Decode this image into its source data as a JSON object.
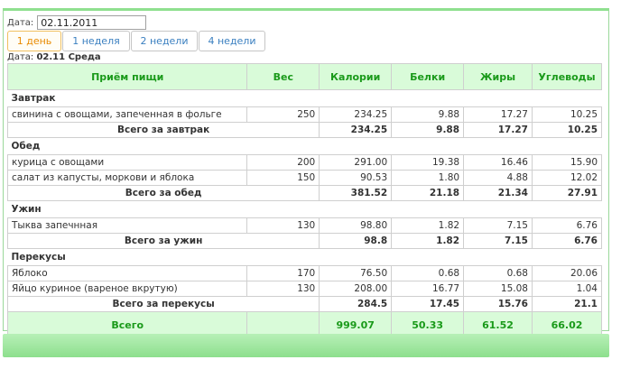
{
  "date_field": {
    "label": "Дата:",
    "value": "02.11.2011"
  },
  "tabs": [
    {
      "label": "1 день",
      "active": true
    },
    {
      "label": "1 неделя",
      "active": false
    },
    {
      "label": "2 недели",
      "active": false
    },
    {
      "label": "4 недели",
      "active": false
    }
  ],
  "day_header": {
    "label": "Дата:",
    "value": "02.11 Среда"
  },
  "columns": [
    "Приём пищи",
    "Вес",
    "Калории",
    "Белки",
    "Жиры",
    "Углеводы"
  ],
  "meals": [
    {
      "name": "Завтрак",
      "items": [
        {
          "name": "свинина с овощами, запеченная в фольге",
          "weight": "250",
          "cal": "234.25",
          "prot": "9.88",
          "fat": "17.27",
          "carb": "10.25"
        }
      ],
      "total": {
        "label": "Всего за завтрак",
        "cal": "234.25",
        "prot": "9.88",
        "fat": "17.27",
        "carb": "10.25"
      }
    },
    {
      "name": "Обед",
      "items": [
        {
          "name": "курица с овощами",
          "weight": "200",
          "cal": "291.00",
          "prot": "19.38",
          "fat": "16.46",
          "carb": "15.90"
        },
        {
          "name": "салат из капусты, моркови и яблока",
          "weight": "150",
          "cal": "90.53",
          "prot": "1.80",
          "fat": "4.88",
          "carb": "12.02"
        }
      ],
      "total": {
        "label": "Всего за обед",
        "cal": "381.52",
        "prot": "21.18",
        "fat": "21.34",
        "carb": "27.91"
      }
    },
    {
      "name": "Ужин",
      "items": [
        {
          "name": "Тыква запечнная",
          "weight": "130",
          "cal": "98.80",
          "prot": "1.82",
          "fat": "7.15",
          "carb": "6.76"
        }
      ],
      "total": {
        "label": "Всего за ужин",
        "cal": "98.8",
        "prot": "1.82",
        "fat": "7.15",
        "carb": "6.76"
      }
    },
    {
      "name": "Перекусы",
      "items": [
        {
          "name": "Яблоко",
          "weight": "170",
          "cal": "76.50",
          "prot": "0.68",
          "fat": "0.68",
          "carb": "20.06"
        },
        {
          "name": "Яйцо куриное (вареное вкрутую)",
          "weight": "130",
          "cal": "208.00",
          "prot": "16.77",
          "fat": "15.08",
          "carb": "1.04"
        }
      ],
      "total": {
        "label": "Всего за перекусы",
        "cal": "284.5",
        "prot": "17.45",
        "fat": "15.76",
        "carb": "21.1"
      }
    }
  ],
  "grand_total": {
    "label": "Всего",
    "cal": "999.07",
    "prot": "50.33",
    "fat": "61.52",
    "carb": "66.02"
  },
  "colors": {
    "accent_green": "#1a9a1a",
    "header_bg": "#d9fbd9",
    "active_tab": "#e88a00",
    "tab_text": "#3a7fc0"
  }
}
